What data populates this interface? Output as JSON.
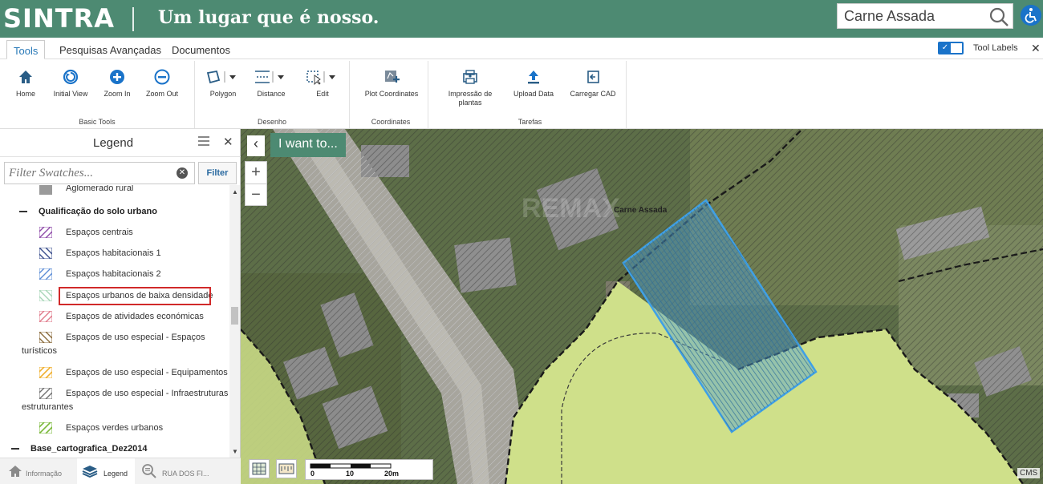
{
  "header": {
    "logo": "SINTRA",
    "tagline": "Um lugar que é nosso.",
    "search_value": "Carne Assada",
    "brand_color": "#4d8a72",
    "accessibility_icon": "wheelchair-icon"
  },
  "tabs": [
    {
      "label": "Tools",
      "active": true
    },
    {
      "label": "Pesquisas Avançadas",
      "active": false
    },
    {
      "label": "Documentos",
      "active": false
    }
  ],
  "tool_labels": "Tool Labels",
  "ribbon": {
    "basic": {
      "title": "Basic Tools",
      "tools": [
        "Home",
        "Initial View",
        "Zoom In",
        "Zoom Out"
      ]
    },
    "desenho": {
      "title": "Desenho",
      "tools": [
        "Polygon",
        "Distance",
        "Edit"
      ]
    },
    "coordinates": {
      "title": "Coordinates",
      "tools": [
        "Plot Coordinates"
      ]
    },
    "tarefas": {
      "title": "Tarefas",
      "tools": [
        "Impressão de plantas",
        "Upload Data",
        "Carregar CAD"
      ]
    }
  },
  "legend": {
    "title": "Legend",
    "filter_placeholder": "Filter Swatches...",
    "filter_button": "Filter",
    "items": [
      {
        "type": "item",
        "label": "Aglomerado rural",
        "color": "#9a9a9a"
      },
      {
        "type": "group",
        "label": "Qualificação do solo urbano"
      },
      {
        "type": "item",
        "label": "Espaços centrais",
        "color": "#8e4aa8"
      },
      {
        "type": "item",
        "label": "Espaços habitacionais 1",
        "color": "#3a4e8c"
      },
      {
        "type": "item",
        "label": "Espaços habitacionais 2",
        "color": "#5b8cd6"
      },
      {
        "type": "item",
        "label": "Espaços urbanos de baixa densidade",
        "color": "#a8d6b8",
        "highlighted": true
      },
      {
        "type": "item",
        "label": "Espaços de atividades económicas",
        "color": "#e07a8a"
      },
      {
        "type": "item",
        "label": "Espaços de uso especial - Espaços",
        "label_cont": "turísticos",
        "color": "#8a6a3a"
      },
      {
        "type": "item",
        "label": "Espaços de uso especial - Equipamentos",
        "color": "#f0b030"
      },
      {
        "type": "item",
        "label": "Espaços de uso especial - Infraestruturas",
        "label_cont": "estruturantes",
        "color": "#707070"
      },
      {
        "type": "item",
        "label": "Espaços verdes urbanos",
        "color": "#7ab83a"
      },
      {
        "type": "group",
        "label": "Base_cartografica_Dez2014"
      }
    ]
  },
  "bottom_tabs": [
    {
      "label": "Informação",
      "icon": "home-icon",
      "active": false
    },
    {
      "label": "Legend",
      "icon": "layers-icon",
      "active": true
    },
    {
      "label": "RUA DOS FI...",
      "icon": "search-result-icon",
      "active": false
    }
  ],
  "map": {
    "i_want_to": "I want to...",
    "place_label": "Carne Assada",
    "scale_labels": [
      "0",
      "10",
      "20m"
    ],
    "attribution": "CMS",
    "selection_color": "#3fa0e6",
    "zone_color": "#cfe08a"
  }
}
